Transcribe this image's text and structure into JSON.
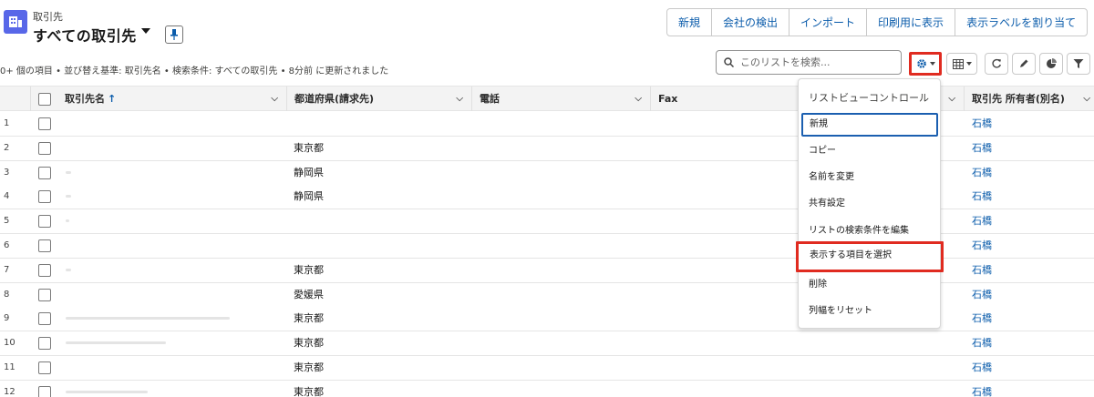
{
  "header": {
    "object_name": "取引先",
    "view_title": "すべての取引先",
    "meta": "0+ 個の項目 • 並び替え基準: 取引先名 • 検索条件: すべての取引先 • 8分前 に更新されました"
  },
  "actions": [
    "新規",
    "会社の検出",
    "インポート",
    "印刷用に表示",
    "表示ラベルを割り当て"
  ],
  "search": {
    "placeholder": "このリストを検索..."
  },
  "toolbar_icons": [
    "gear-icon",
    "table-icon",
    "refresh-icon",
    "pencil-icon",
    "chart-icon",
    "filter-icon"
  ],
  "columns": {
    "name": "取引先名",
    "name_sort": "↑",
    "prefecture": "都道府県(請求先)",
    "phone": "電話",
    "fax": "Fax",
    "owner": "取引先 所有者(別名)"
  },
  "rows": [
    {
      "num": "1",
      "prefecture": "",
      "owner": "石橋"
    },
    {
      "num": "2",
      "prefecture": "東京都",
      "owner": "石橋"
    },
    {
      "num": "3",
      "prefecture": "静岡県",
      "owner": "石橋"
    },
    {
      "num": "4",
      "prefecture": "静岡県",
      "owner": "石橋"
    },
    {
      "num": "5",
      "prefecture": "",
      "owner": "石橋"
    },
    {
      "num": "6",
      "prefecture": "",
      "owner": "石橋"
    },
    {
      "num": "7",
      "prefecture": "東京都",
      "owner": "石橋"
    },
    {
      "num": "8",
      "prefecture": "愛媛県",
      "owner": "石橋"
    },
    {
      "num": "9",
      "prefecture": "東京都",
      "owner": "石橋"
    },
    {
      "num": "10",
      "prefecture": "東京都",
      "owner": "石橋"
    },
    {
      "num": "11",
      "prefecture": "東京都",
      "owner": "石橋"
    },
    {
      "num": "12",
      "prefecture": "東京都",
      "owner": "石橋"
    }
  ],
  "menu": {
    "header": "リストビューコントロール",
    "items": [
      "新規",
      "コピー",
      "名前を変更",
      "共有設定",
      "リストの検索条件を編集",
      "表示する項目を選択",
      "削除",
      "列幅をリセット"
    ]
  },
  "colors": {
    "accent": "#0b5cab",
    "highlight": "#e02b20",
    "app_icon": "#5867e8"
  }
}
